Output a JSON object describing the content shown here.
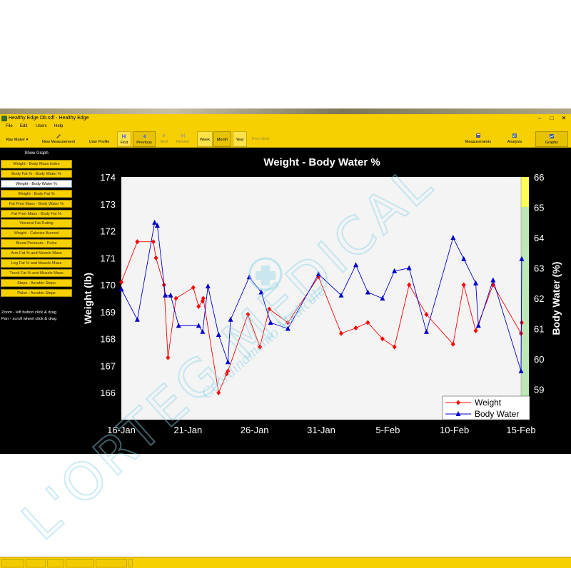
{
  "window": {
    "title": "Healthy Edge Db.sdf - Healthy Edge",
    "controls": [
      "–",
      "□",
      "✕"
    ]
  },
  "menu": [
    "File",
    "Edit",
    "Users",
    "Help"
  ],
  "toolbar": {
    "user": "Ray Maker",
    "new_measurement": "New Measurement",
    "user_profile": "User Profile",
    "first": "First",
    "previous": "Previous",
    "next": "Next",
    "rewind": "Rewind",
    "week": "Week",
    "month": "Month",
    "year": "Year",
    "prev_view": "Prev View",
    "measurements": "Measurements",
    "analysis": "Analysis",
    "graphs": "Graphs"
  },
  "sidebar": {
    "header": "Show Graph",
    "items": [
      {
        "label": "Weight - Body Mass Index",
        "active": false
      },
      {
        "label": "Body Fat % - Body Water %",
        "active": false
      },
      {
        "label": "Weight - Body Water %",
        "active": true
      },
      {
        "label": "Weight - Body Fat %",
        "active": false
      },
      {
        "label": "Fat Free Mass - Body Water %",
        "active": false
      },
      {
        "label": "Fat Free Mass - Body Fat %",
        "active": false
      },
      {
        "label": "Visceral Fat Rating",
        "active": false
      },
      {
        "label": "Weight - Calories Burned",
        "active": false
      },
      {
        "label": "Blood Pressure - Pulse",
        "active": false
      },
      {
        "label": "Arm Fat % and Muscle Mass",
        "active": false
      },
      {
        "label": "Leg Fat % and Muscle Mass",
        "active": false
      },
      {
        "label": "Trunk Fat % and Muscle Mass",
        "active": false
      },
      {
        "label": "Steps - Aerobic Steps",
        "active": false
      },
      {
        "label": "Pulse - Aerobic Steps",
        "active": false
      }
    ],
    "zoom_hint": "Zoom - left button click & drag",
    "pan_hint": "Pan - scroll wheel click & drag"
  },
  "watermark": {
    "brand": "L'ORTEG MEDICAL",
    "subtext": "Coordinamento Medicale"
  },
  "chart_data": {
    "type": "line",
    "title": "Weight - Body Water %",
    "xlabel": "",
    "ylabel": "Weight (lb)",
    "y2label": "Body Water (%)",
    "ylim": [
      165,
      174
    ],
    "y2lim": [
      58,
      66
    ],
    "yticks": [
      166,
      167,
      168,
      169,
      170,
      171,
      172,
      173,
      174
    ],
    "y2ticks": [
      59,
      60,
      61,
      62,
      63,
      64,
      65,
      66
    ],
    "xtick_labels": [
      "16-Jan",
      "21-Jan",
      "26-Jan",
      "31-Jan",
      "5-Feb",
      "10-Feb",
      "15-Feb"
    ],
    "xtick_days": [
      0,
      5,
      10,
      15,
      20,
      25,
      30
    ],
    "x_unit": "days from 16-Jan",
    "grid": false,
    "legend": "bottom-right",
    "colors": {
      "weight": "#ff0000",
      "water": "#0000cc",
      "plot_bg": "#f4f4f4",
      "green_zone": "#bde8b5",
      "yellow_zone": "#ffff55"
    },
    "series": [
      {
        "name": "Weight",
        "axis": "left",
        "marker": "diamond",
        "x": [
          0,
          1.2,
          2.4,
          2.6,
          3.2,
          3.5,
          4.1,
          5.4,
          5.8,
          6.1,
          6.15,
          7.3,
          7.9,
          8.0,
          9.5,
          10.4,
          11.1,
          12.5,
          14.8,
          16.5,
          17.6,
          18.5,
          19.6,
          20.5,
          21.6,
          22.9,
          24.9,
          25.7,
          26.6,
          27.9,
          30.0,
          30.05
        ],
        "y": [
          170.1,
          171.6,
          171.6,
          171.0,
          170.0,
          167.3,
          169.5,
          169.9,
          169.2,
          169.4,
          169.5,
          166.0,
          166.7,
          166.8,
          168.9,
          167.7,
          169.1,
          168.6,
          170.3,
          168.2,
          168.4,
          168.6,
          168.0,
          167.7,
          170.0,
          168.9,
          167.8,
          170.0,
          168.3,
          170.0,
          168.2,
          168.6
        ]
      },
      {
        "name": "Body Water",
        "axis": "right",
        "marker": "triangle",
        "x": [
          0,
          1.2,
          2.5,
          2.7,
          3.3,
          3.7,
          4.3,
          5.8,
          6.1,
          6.5,
          7.3,
          8.0,
          8.2,
          9.6,
          10.5,
          11.2,
          12.5,
          14.8,
          16.5,
          17.6,
          18.5,
          19.6,
          20.5,
          21.6,
          22.9,
          24.9,
          25.7,
          26.6,
          26.8,
          27.9,
          30.0,
          30.05
        ],
        "y": [
          62.3,
          61.3,
          64.5,
          64.4,
          62.1,
          62.1,
          61.1,
          61.1,
          60.9,
          62.4,
          60.8,
          59.9,
          61.3,
          62.7,
          62.2,
          61.2,
          61.0,
          62.8,
          62.1,
          63.1,
          62.2,
          62.0,
          62.9,
          63.0,
          60.9,
          64.0,
          63.3,
          62.5,
          61.1,
          62.6,
          59.6,
          63.3
        ]
      }
    ]
  }
}
